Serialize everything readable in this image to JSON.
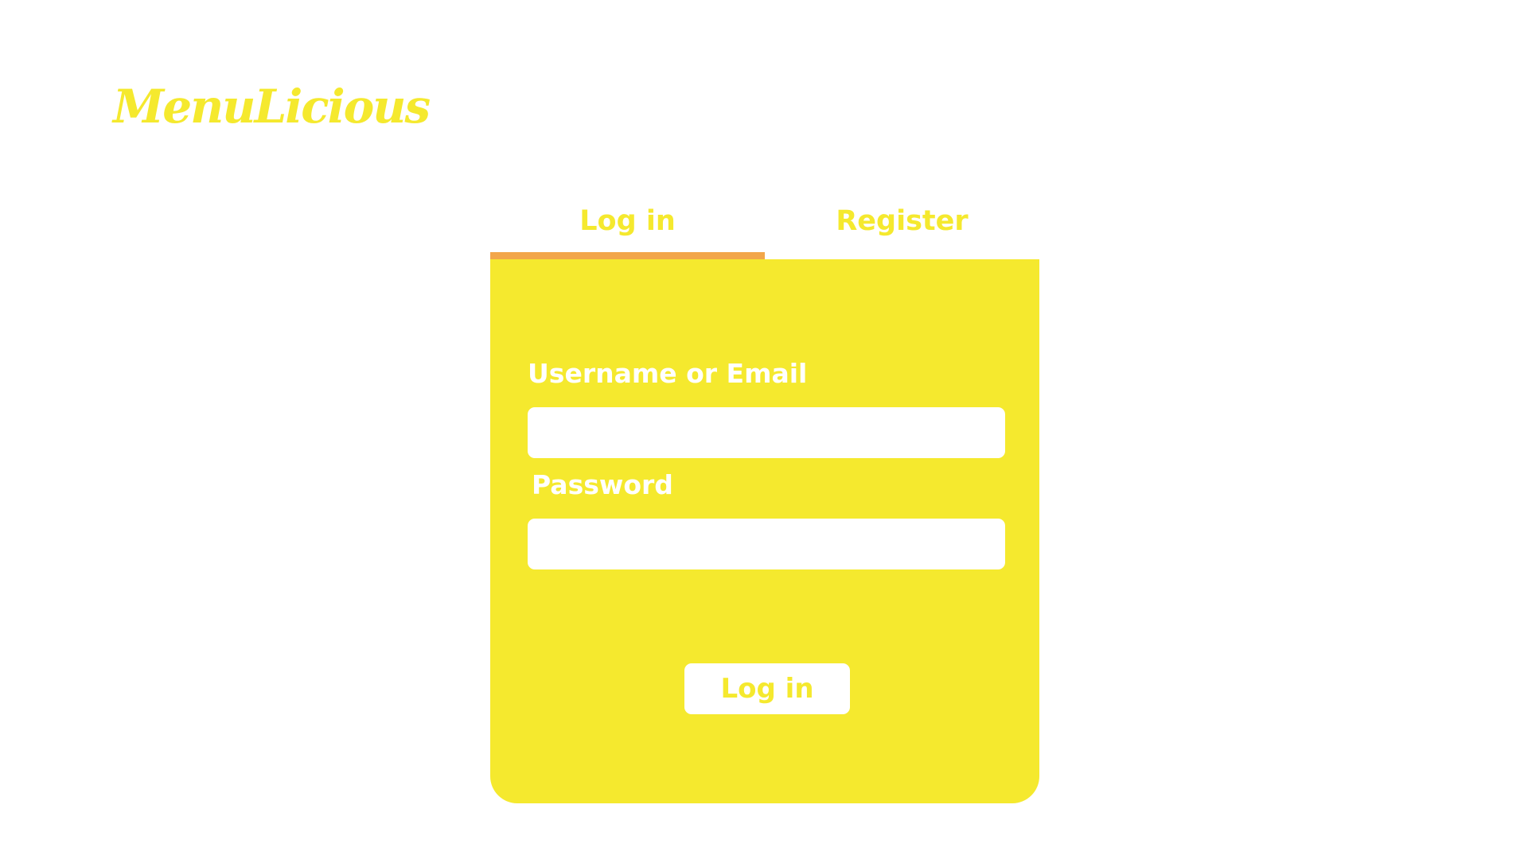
{
  "brand": {
    "name": "MenuLicious"
  },
  "tabs": [
    {
      "label": "Log in",
      "active": true
    },
    {
      "label": "Register",
      "active": false
    }
  ],
  "form": {
    "username_label": "Username or Email",
    "username_value": "",
    "password_label": "Password",
    "password_value": "",
    "submit_label": "Log in"
  },
  "colors": {
    "accent_yellow": "#f5e92e",
    "active_tab_underline": "#f2a64a",
    "background": "#ffffff",
    "field_background": "#ffffff",
    "label_text": "#ffffff"
  }
}
